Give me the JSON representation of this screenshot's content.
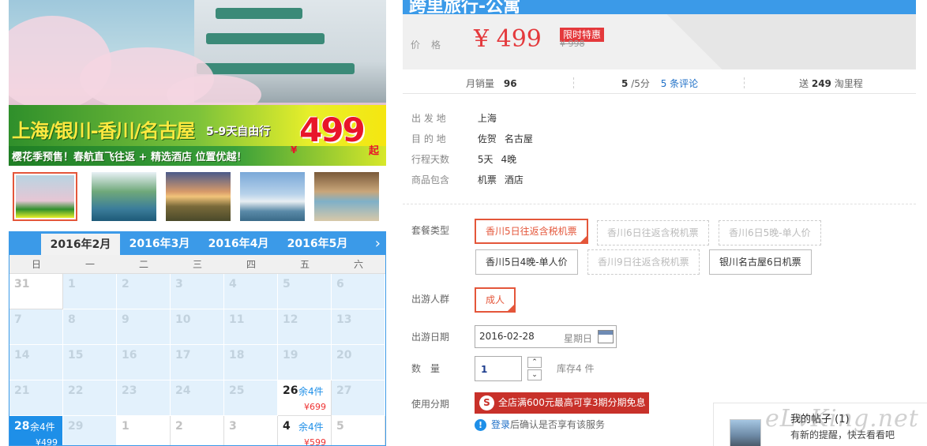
{
  "hero": {
    "headline": "上海/银川-香川/名古屋",
    "sub": "5-9天自由行",
    "tagline": "樱花季预售！春航直飞往返 + 精选酒店 位置优越！",
    "price": "499",
    "yen": "¥",
    "qi": "起"
  },
  "thumbnails": [
    {
      "name": "castle-sakura",
      "color": "linear-gradient(180deg,#b9d4e2,#e6c6d4 60%,#2f8f2b 80%,#e8ef2a)"
    },
    {
      "name": "garden-pond",
      "color": "linear-gradient(180deg,#e8f0f6 0%,#6fa87a 40%,#3b7d9a 75%,#1e5a78 100%)"
    },
    {
      "name": "sunset-field",
      "color": "linear-gradient(180deg,#4a5a8a 0%,#d69a6a 40%,#f2c47a 50%,#7a6a3a 70%,#4a4a2a 100%)"
    },
    {
      "name": "windmill-sea",
      "color": "linear-gradient(180deg,#7aa8d8 0%,#b7d2ea 45%,#e8eef2 60%,#5a8aa8 80%,#3a6a88 100%)"
    },
    {
      "name": "people-yukata",
      "color": "linear-gradient(180deg,#7a5a3a 0%,#c9a67a 40%,#7fb0c8 60%,#d8c8a8 100%)"
    }
  ],
  "calendar": {
    "tabs": [
      "2016年2月",
      "2016年3月",
      "2016年4月",
      "2016年5月"
    ],
    "next": "›",
    "weekdays": [
      "日",
      "一",
      "二",
      "三",
      "四",
      "五",
      "六"
    ],
    "rows": [
      [
        {
          "d": "31",
          "t": "white"
        },
        {
          "d": "1"
        },
        {
          "d": "2"
        },
        {
          "d": "3"
        },
        {
          "d": "4"
        },
        {
          "d": "5"
        },
        {
          "d": "6"
        }
      ],
      [
        {
          "d": "7"
        },
        {
          "d": "8"
        },
        {
          "d": "9"
        },
        {
          "d": "10"
        },
        {
          "d": "11"
        },
        {
          "d": "12"
        },
        {
          "d": "13"
        }
      ],
      [
        {
          "d": "14"
        },
        {
          "d": "15"
        },
        {
          "d": "16"
        },
        {
          "d": "17"
        },
        {
          "d": "18"
        },
        {
          "d": "19"
        },
        {
          "d": "20"
        }
      ],
      [
        {
          "d": "21"
        },
        {
          "d": "22"
        },
        {
          "d": "23"
        },
        {
          "d": "24"
        },
        {
          "d": "25"
        },
        {
          "d": "26",
          "t": "white",
          "avail": true,
          "stock": "余4件",
          "price": "¥699"
        },
        {
          "d": "27"
        }
      ],
      [
        {
          "d": "28",
          "t": "sel",
          "stock": "余4件",
          "price": "¥499"
        },
        {
          "d": "29"
        },
        {
          "d": "1",
          "t": "white"
        },
        {
          "d": "2",
          "t": "white"
        },
        {
          "d": "3",
          "t": "white"
        },
        {
          "d": "4",
          "t": "white",
          "avail": true,
          "stock": "余4件",
          "price": "¥599"
        },
        {
          "d": "5",
          "t": "white"
        }
      ]
    ]
  },
  "title": "跨里旅行-公寓",
  "price": {
    "label": "价格",
    "now": "¥ 499",
    "flag": "限时特惠",
    "old": "¥ 998"
  },
  "stats": {
    "monthly_label": "月销量",
    "monthly_value": "96",
    "rating_value": "5",
    "rating_suffix": "/5分",
    "reviews_count": "5",
    "reviews_label": "条评论",
    "points_prefix": "送",
    "points_value": "249",
    "points_suffix": "淘里程"
  },
  "info": [
    {
      "k": "出 发 地",
      "v": [
        "上海"
      ]
    },
    {
      "k": "目 的 地",
      "v": [
        "佐贺",
        "名古屋"
      ]
    },
    {
      "k": "行程天数",
      "v": [
        "5天",
        "4晚"
      ]
    },
    {
      "k": "商品包含",
      "v": [
        "机票",
        "酒店"
      ]
    }
  ],
  "options": {
    "package_label": "套餐类型",
    "packages": [
      {
        "label": "香川5日往返含税机票",
        "state": "selected"
      },
      {
        "label": "香川6日往返含税机票",
        "state": "disabled"
      },
      {
        "label": "香川6日5晚-单人价",
        "state": "disabled"
      },
      {
        "label": "香川5日4晚-单人价",
        "state": "normal"
      },
      {
        "label": "香川9日往返含税机票",
        "state": "disabled"
      },
      {
        "label": "银川名古屋6日机票",
        "state": "normal"
      }
    ],
    "crowd_label": "出游人群",
    "crowd": "成人",
    "date_label": "出游日期",
    "date_value": "2016-02-28",
    "date_weekday": "星期日",
    "qty_label": "数　量",
    "qty_value": "1",
    "qty_up": "⌃",
    "qty_down": "⌄",
    "stock_text": "库存4 件",
    "install_label": "使用分期",
    "install_text": "全店满600元最高可享3期分期免息",
    "install_icon": "S",
    "login_link": "登录",
    "login_text": "后确认是否享有该服务",
    "login_icon": "!"
  },
  "notify": {
    "title": "我的帖子 (1)",
    "text": "有新的提醒，快去看看吧",
    "watermark": "eLvKing.net"
  }
}
